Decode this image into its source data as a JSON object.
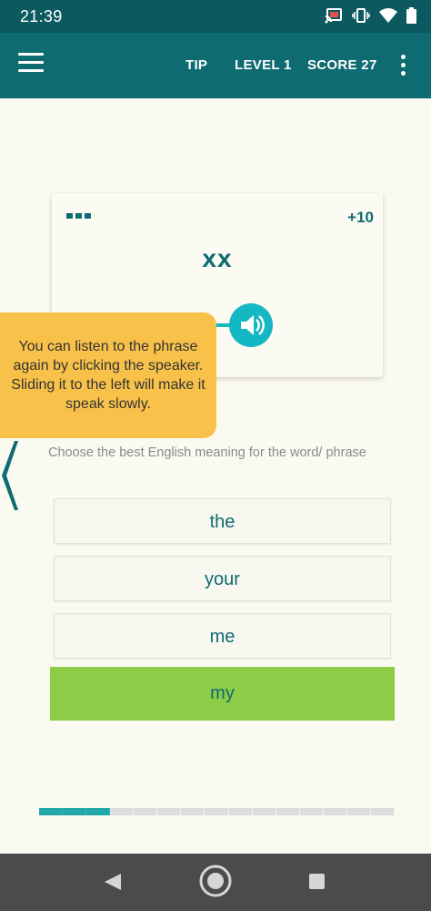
{
  "status_bar": {
    "time": "21:39",
    "icons": [
      "cast-icon",
      "vibrate-icon",
      "wifi-icon",
      "battery-icon"
    ]
  },
  "app_bar": {
    "menu_icon": "hamburger-menu-icon",
    "tip_label": "TIP",
    "level_label": "LEVEL 1",
    "score_label": "SCORE 27",
    "more_icon": "more-vertical-icon"
  },
  "card": {
    "points": "+10",
    "word": "xx",
    "speaker_icon": "speaker-icon"
  },
  "tooltip": {
    "text": "You can listen to the phrase again by clicking the speaker. Sliding it to the left will make it speak slowly."
  },
  "instruction": "Choose the best English meaning for the word/ phrase",
  "options": [
    {
      "label": "the",
      "selected": false
    },
    {
      "label": "your",
      "selected": false
    },
    {
      "label": "me",
      "selected": false
    },
    {
      "label": "my",
      "selected": true
    }
  ],
  "progress": {
    "completed_steps": 3,
    "total_steps": 15
  },
  "colors": {
    "primary": "#0e6b71",
    "accent": "#14b8c2",
    "tooltip": "#f8c24a",
    "selected_option": "#8ccc47",
    "progress": "#22a7a8"
  },
  "nav_bar": {
    "icons": [
      "back-icon",
      "home-icon",
      "recents-icon"
    ]
  }
}
